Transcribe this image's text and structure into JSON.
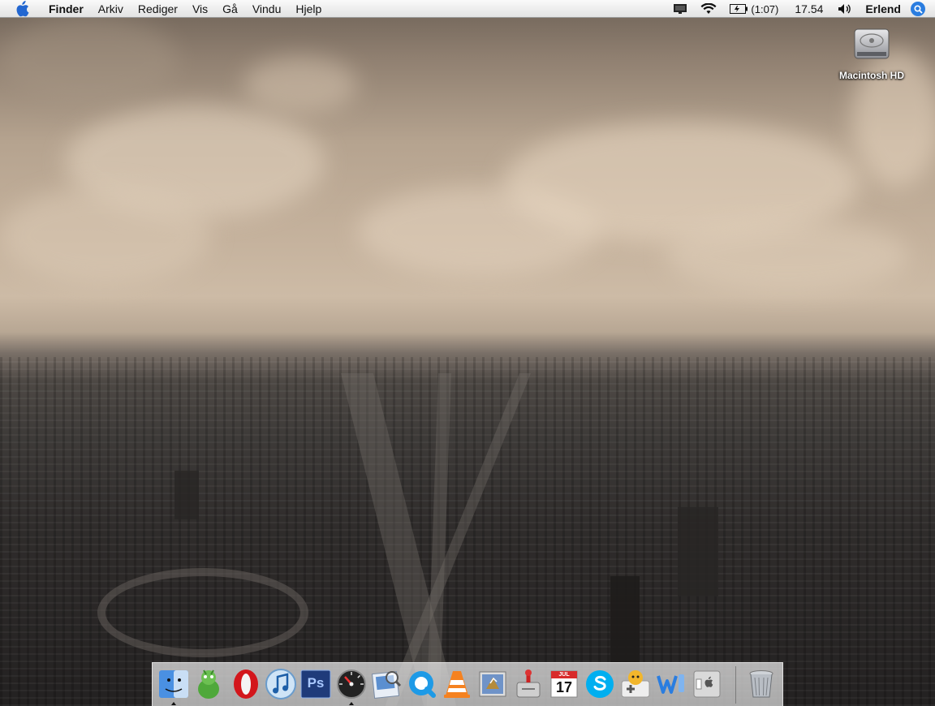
{
  "menubar": {
    "app_name": "Finder",
    "menus": [
      "Arkiv",
      "Rediger",
      "Vis",
      "Gå",
      "Vindu",
      "Hjelp"
    ],
    "battery_text": "(1:07)",
    "clock": "17.54",
    "user": "Erlend"
  },
  "desktop": {
    "icons": [
      {
        "label": "Macintosh HD",
        "icon": "hard-drive-icon"
      }
    ]
  },
  "dock": {
    "apps": [
      {
        "name": "finder-icon",
        "running": true
      },
      {
        "name": "adium-icon",
        "running": false
      },
      {
        "name": "opera-icon",
        "running": false
      },
      {
        "name": "itunes-icon",
        "running": false
      },
      {
        "name": "photoshop-icon",
        "running": false
      },
      {
        "name": "dashboard-icon",
        "running": true
      },
      {
        "name": "preview-icon",
        "running": false
      },
      {
        "name": "quicktime-icon",
        "running": false
      },
      {
        "name": "vlc-icon",
        "running": false
      },
      {
        "name": "mail-icon",
        "running": false
      },
      {
        "name": "transmission-icon",
        "running": false
      },
      {
        "name": "ical-icon",
        "running": false
      },
      {
        "name": "skype-icon",
        "running": false
      },
      {
        "name": "growl-icon",
        "running": false
      },
      {
        "name": "word-icon",
        "running": false
      },
      {
        "name": "system-preferences-icon",
        "running": false
      },
      {
        "name": "trash-icon",
        "running": false
      }
    ],
    "ical_day": "17",
    "ical_month": "JUL",
    "photoshop_label": "Ps"
  },
  "colors": {
    "accent": "#2a7de0",
    "menubar_top": "#fafafa",
    "menubar_bottom": "#e2e2e2"
  }
}
